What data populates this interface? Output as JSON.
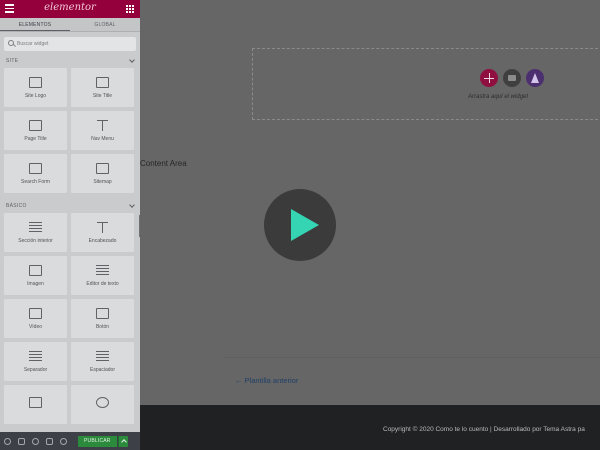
{
  "sidebar": {
    "logo": "elementor",
    "tabs": [
      {
        "label": "ELEMENTOS"
      },
      {
        "label": "GLOBAL"
      }
    ],
    "search_placeholder": "Buscar widget",
    "sections": [
      {
        "title": "SITE",
        "widgets": [
          {
            "label": "Site Logo",
            "icon": "site-logo-icon"
          },
          {
            "label": "Site Title",
            "icon": "site-title-icon"
          },
          {
            "label": "Page Title",
            "icon": "page-title-icon"
          },
          {
            "label": "Nav Menu",
            "icon": "nav-menu-icon"
          },
          {
            "label": "Search Form",
            "icon": "search-form-icon"
          },
          {
            "label": "Sitemap",
            "icon": "sitemap-icon"
          }
        ]
      },
      {
        "title": "BÁSICO",
        "widgets": [
          {
            "label": "Sección interior",
            "icon": "inner-section-icon"
          },
          {
            "label": "Encabezado",
            "icon": "heading-icon"
          },
          {
            "label": "Imagen",
            "icon": "image-icon"
          },
          {
            "label": "Editor de texto",
            "icon": "text-editor-icon"
          },
          {
            "label": "Vídeo",
            "icon": "video-icon"
          },
          {
            "label": "Botón",
            "icon": "button-icon"
          },
          {
            "label": "Separador",
            "icon": "divider-icon"
          },
          {
            "label": "Espaciador",
            "icon": "spacer-icon"
          },
          {
            "label": "",
            "icon": "image-box-icon"
          },
          {
            "label": "",
            "icon": "icon-box-icon"
          }
        ]
      }
    ],
    "footer": {
      "publish_label": "PUBLICAR"
    }
  },
  "canvas": {
    "drop_text": "Arrastra aquí el widget",
    "content_area": "Content Area",
    "prev_link": "← Plantilla anterior",
    "copyright": "Copyright © 2020 Como te lo cuento | Desarrollado por Tema Astra pa"
  },
  "colors": {
    "brand": "#93003c",
    "publish": "#2c8a3c",
    "play_accent": "#35d5b4"
  }
}
